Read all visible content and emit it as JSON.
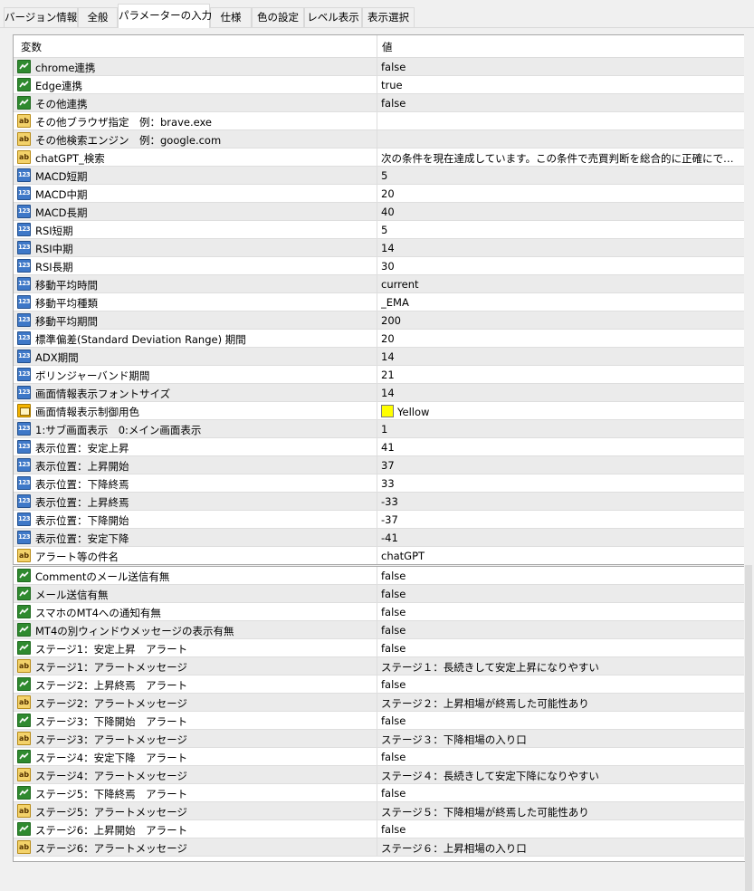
{
  "tabs": [
    {
      "label": "バージョン情報"
    },
    {
      "label": "全般"
    },
    {
      "label": "パラメーターの入力",
      "active": true
    },
    {
      "label": "仕様"
    },
    {
      "label": "色の設定"
    },
    {
      "label": "レベル表示"
    },
    {
      "label": "表示選択"
    }
  ],
  "table": {
    "header_name": "変数",
    "header_value": "値",
    "top_rows": [
      {
        "type": "bool",
        "name": "chrome連携",
        "value": "false"
      },
      {
        "type": "bool",
        "name": "Edge連携",
        "value": "true"
      },
      {
        "type": "bool",
        "name": "その他連携",
        "value": "false"
      },
      {
        "type": "str",
        "name": "その他ブラウザ指定　例：brave.exe",
        "value": ""
      },
      {
        "type": "str",
        "name": "その他検索エンジン　例：google.com",
        "value": ""
      },
      {
        "type": "str",
        "name": "chatGPT_検索",
        "value": "次の条件を現在達成しています。この条件で売買判断を総合的に正確にできるだ…"
      },
      {
        "type": "int",
        "name": "MACD短期",
        "value": "5"
      },
      {
        "type": "int",
        "name": "MACD中期",
        "value": "20"
      },
      {
        "type": "int",
        "name": "MACD長期",
        "value": "40"
      },
      {
        "type": "int",
        "name": "RSI短期",
        "value": "5"
      },
      {
        "type": "int",
        "name": "RSI中期",
        "value": "14"
      },
      {
        "type": "int",
        "name": "RSI長期",
        "value": "30"
      },
      {
        "type": "int",
        "name": "移動平均時間",
        "value": "current"
      },
      {
        "type": "int",
        "name": "移動平均種類",
        "value": "_EMA"
      },
      {
        "type": "int",
        "name": "移動平均期間",
        "value": "200"
      },
      {
        "type": "int",
        "name": "標準偏差(Standard Deviation Range) 期間",
        "value": "20"
      },
      {
        "type": "int",
        "name": "ADX期間",
        "value": "14"
      },
      {
        "type": "int",
        "name": "ボリンジャーバンド期間",
        "value": "21"
      },
      {
        "type": "int",
        "name": "画面情報表示フォントサイズ",
        "value": "14"
      },
      {
        "type": "color",
        "name": "画面情報表示制御用色",
        "value": "Yellow",
        "swatch": "#ffff00"
      },
      {
        "type": "int",
        "name": "1:サブ画面表示　0:メイン画面表示",
        "value": "1"
      },
      {
        "type": "int",
        "name": "表示位置：安定上昇",
        "value": "41"
      },
      {
        "type": "int",
        "name": "表示位置：上昇開始",
        "value": "37"
      },
      {
        "type": "int",
        "name": "表示位置：下降終焉",
        "value": "33"
      },
      {
        "type": "int",
        "name": "表示位置：上昇終焉",
        "value": "-33"
      },
      {
        "type": "int",
        "name": "表示位置：下降開始",
        "value": "-37"
      },
      {
        "type": "int",
        "name": "表示位置：安定下降",
        "value": "-41"
      },
      {
        "type": "str",
        "name": "アラート等の件名",
        "value": "chatGPT"
      }
    ],
    "bottom_rows": [
      {
        "type": "bool",
        "name": "Commentのメール送信有無",
        "value": "false"
      },
      {
        "type": "bool",
        "name": "メール送信有無",
        "value": "false"
      },
      {
        "type": "bool",
        "name": "スマホのMT4への通知有無",
        "value": "false"
      },
      {
        "type": "bool",
        "name": "MT4の別ウィンドウメッセージの表示有無",
        "value": "false"
      },
      {
        "type": "bool",
        "name": "ステージ1：安定上昇　アラート",
        "value": "false"
      },
      {
        "type": "str",
        "name": "ステージ1：アラートメッセージ",
        "value": "ステージ１：長続きして安定上昇になりやすい"
      },
      {
        "type": "bool",
        "name": "ステージ2：上昇終焉　アラート",
        "value": "false"
      },
      {
        "type": "str",
        "name": "ステージ2：アラートメッセージ",
        "value": "ステージ２：上昇相場が終焉した可能性あり"
      },
      {
        "type": "bool",
        "name": "ステージ3：下降開始　アラート",
        "value": "false"
      },
      {
        "type": "str",
        "name": "ステージ3：アラートメッセージ",
        "value": "ステージ３：下降相場の入り口"
      },
      {
        "type": "bool",
        "name": "ステージ4：安定下降　アラート",
        "value": "false"
      },
      {
        "type": "str",
        "name": "ステージ4：アラートメッセージ",
        "value": "ステージ４：長続きして安定下降になりやすい"
      },
      {
        "type": "bool",
        "name": "ステージ5：下降終焉　アラート",
        "value": "false"
      },
      {
        "type": "str",
        "name": "ステージ5：アラートメッセージ",
        "value": "ステージ５：下降相場が終焉した可能性あり"
      },
      {
        "type": "bool",
        "name": "ステージ6：上昇開始　アラート",
        "value": "false"
      },
      {
        "type": "str",
        "name": "ステージ6：アラートメッセージ",
        "value": "ステージ６：上昇相場の入り口"
      }
    ]
  },
  "icons": {
    "bool": "boolean-param-icon",
    "str": "string-param-icon",
    "int": "integer-param-icon",
    "color": "color-param-icon"
  },
  "icon_text": {
    "str": "ab",
    "int": "123"
  },
  "colors": {
    "alt_row": "#ebebeb",
    "tab_active": "#ffffff",
    "yellow_swatch": "#ffff00"
  }
}
